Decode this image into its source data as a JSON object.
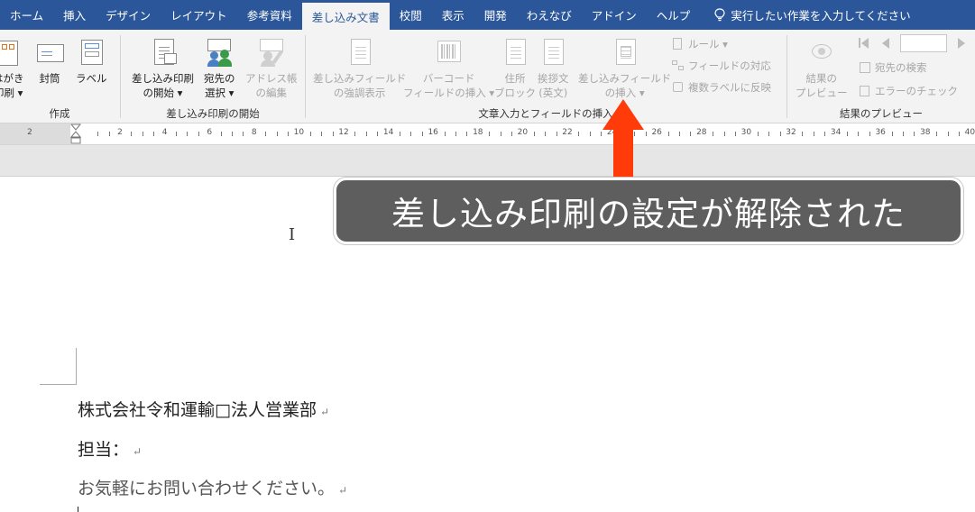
{
  "tabs": [
    {
      "label": "ホーム",
      "name": "home"
    },
    {
      "label": "挿入",
      "name": "insert"
    },
    {
      "label": "デザイン",
      "name": "design"
    },
    {
      "label": "レイアウト",
      "name": "layout"
    },
    {
      "label": "参考資料",
      "name": "references"
    },
    {
      "label": "差し込み文書",
      "name": "mailings",
      "active": true
    },
    {
      "label": "校閲",
      "name": "review"
    },
    {
      "label": "表示",
      "name": "view"
    },
    {
      "label": "開発",
      "name": "developer"
    },
    {
      "label": "わえなび",
      "name": "waenavi"
    },
    {
      "label": "アドイン",
      "name": "addins"
    },
    {
      "label": "ヘルプ",
      "name": "help"
    }
  ],
  "tell_me": "実行したい作業を入力してください",
  "ribbon": {
    "create": {
      "label": "作成",
      "hagaki_line1": "はがき",
      "hagaki_line2": "印刷 ▾",
      "envelope": "封筒",
      "labels": "ラベル"
    },
    "start_merge": {
      "label": "差し込み印刷の開始",
      "start_line1": "差し込み印刷",
      "start_line2": "の開始 ▾",
      "select_line1": "宛先の",
      "select_line2": "選択 ▾",
      "edit_line1": "アドレス帳",
      "edit_line2": "の編集"
    },
    "write_insert": {
      "label": "文章入力とフィールドの挿入",
      "highlight_line1": "差し込みフィールド",
      "highlight_line2": "の強調表示",
      "barcode_line1": "バーコード",
      "barcode_line2": "フィールドの挿入 ▾",
      "address_line1": "住所",
      "address_line2": "ブロック",
      "greeting_line1": "挨拶文",
      "greeting_line2": "(英文)",
      "insert_field_line1": "差し込みフィールド",
      "insert_field_line2": "の挿入 ▾",
      "rules": "ルール ▾",
      "match_fields": "フィールドの対応",
      "update_labels": "複数ラベルに反映"
    },
    "preview": {
      "label": "結果のプレビュー",
      "preview_line1": "結果の",
      "preview_line2": "プレビュー",
      "find_recipient": "宛先の検索",
      "check_errors": "エラーのチェック"
    }
  },
  "ruler": {
    "left_label": "2",
    "marks": [
      "2",
      "4",
      "6",
      "8",
      "10",
      "12",
      "14",
      "16",
      "18",
      "20",
      "22",
      "24",
      "26",
      "28",
      "30",
      "32",
      "34",
      "36",
      "38",
      "40"
    ]
  },
  "document": {
    "line1": "株式会社令和運輸□法人営業部",
    "line2": "担当：",
    "line3": "お気軽にお問い合わせください。",
    "para_mark": "↵"
  },
  "callout": "差し込み印刷の設定が解除された",
  "colors": {
    "tabbar": "#2b579a",
    "ribbon": "#f3f3f3",
    "callout_bg": "#5e5e5e",
    "arrow": "#ff3b0a"
  }
}
